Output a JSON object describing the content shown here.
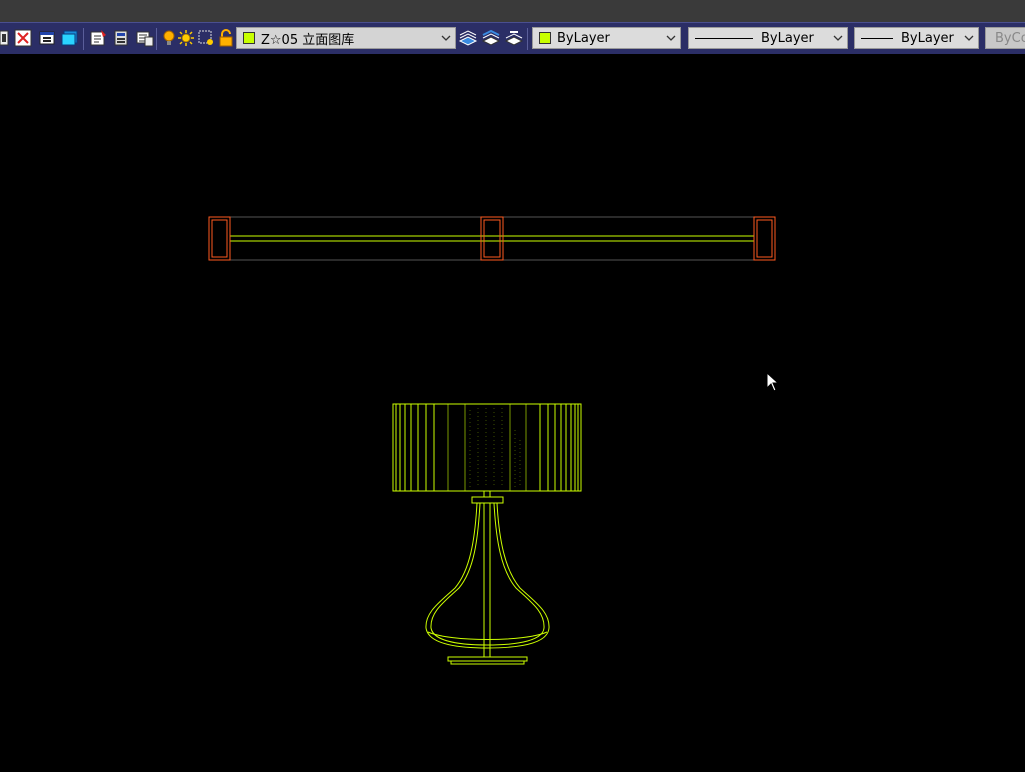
{
  "toolbar": {
    "layer_dropdown": {
      "value": "Z☆05 立面图库",
      "swatch_color": "#c8ff00"
    },
    "color_dropdown": {
      "value": "ByLayer",
      "swatch_color": "#c8ff00"
    },
    "linetype_dropdown": {
      "value": "ByLayer"
    },
    "lineweight_dropdown": {
      "value": "ByLayer"
    },
    "plotstyle_dropdown": {
      "value": "ByCo"
    }
  },
  "colors": {
    "background": "#000000",
    "toolbar_bg": "#2b2e66",
    "drawing_yellow": "#ccff00",
    "drawing_orange": "#ff5a1f",
    "drawing_gray": "#555555"
  },
  "icons": [
    "layer-manager-icon",
    "layer-close-icon",
    "layer-state-icon",
    "layer-toggle-icon",
    "match-layer-icon",
    "layer-previous-icon",
    "layer-iso-icon",
    "bulb-on-icon",
    "sun-icon",
    "freeze-viewport-icon",
    "lock-icon",
    "layer-walk-icon",
    "layer-merge-icon",
    "layer-delete-icon"
  ]
}
